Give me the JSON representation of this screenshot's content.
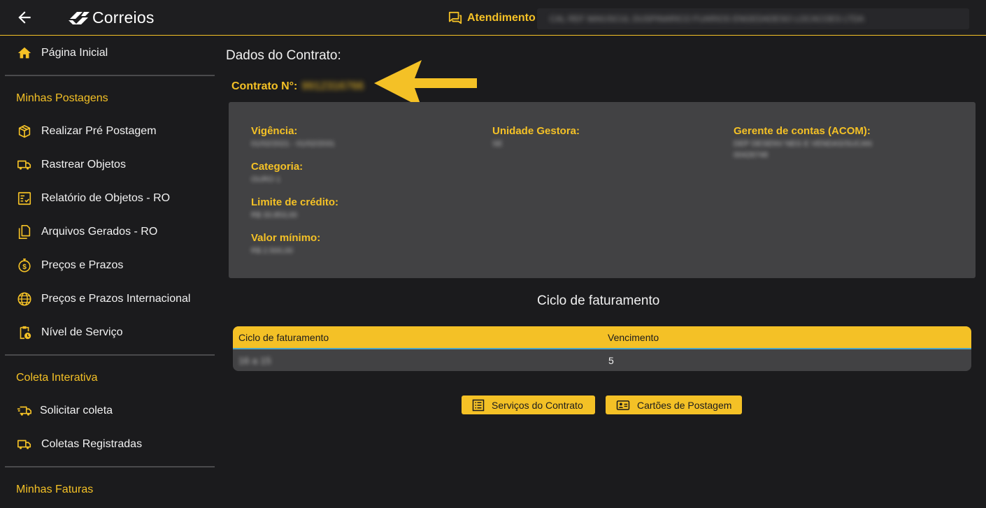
{
  "header": {
    "logo_text": "Correios",
    "atendimento_label": "Atendimento",
    "blurred_info": "CAL REF MAIUSCUL DUSPINARICO FUARIOS ENGEDADESO LOCACOES LTDA"
  },
  "sidebar": {
    "home_label": "Página Inicial",
    "section_postagens": "Minhas Postagens",
    "items_postagens": [
      {
        "label": "Realizar Pré Postagem",
        "icon": "package-icon"
      },
      {
        "label": "Rastrear Objetos",
        "icon": "truck-icon"
      },
      {
        "label": "Relatório de Objetos - RO",
        "icon": "report-icon"
      },
      {
        "label": "Arquivos Gerados - RO",
        "icon": "files-icon"
      },
      {
        "label": "Preços e Prazos",
        "icon": "price-icon"
      },
      {
        "label": "Preços e Prazos Internacional",
        "icon": "globe-icon"
      },
      {
        "label": "Nível de Serviço",
        "icon": "clipboard-clock-icon"
      }
    ],
    "section_coleta": "Coleta Interativa",
    "items_coleta": [
      {
        "label": "Solicitar coleta",
        "icon": "fast-truck-icon"
      },
      {
        "label": "Coletas Registradas",
        "icon": "truck-icon"
      }
    ],
    "section_faturas": "Minhas Faturas"
  },
  "main": {
    "title": "Dados do Contrato:",
    "contract_label": "Contrato N°:",
    "contract_number": "9912316766",
    "fields": {
      "vigencia_label": "Vigência:",
      "vigencia_value": "01/02/2021 - 01/02/2031",
      "categoria_label": "Categoria:",
      "categoria_value": "OURO 1",
      "limite_label": "Limite de crédito:",
      "limite_value": "R$ 33.853,00",
      "valor_label": "Valor mínimo:",
      "valor_value": "R$ 2.500,00",
      "unidade_label": "Unidade Gestora:",
      "unidade_value": "SE",
      "gerente_label": "Gerente de contas (ACOM):",
      "gerente_value_1": "DEP DESENV NEG E VENDAS/SUCAN",
      "gerente_value_2": "00426748"
    },
    "ciclo_title": "Ciclo de faturamento",
    "table": {
      "col_ciclo": "Ciclo de faturamento",
      "col_vencimento": "Vencimento",
      "row_ciclo": "16 a 15",
      "row_vencimento": "5"
    },
    "btn_servicos": "Serviços do Contrato",
    "btn_cartoes": "Cartões de Postagem"
  },
  "colors": {
    "accent": "#f4c126",
    "background": "#1b1b1d",
    "panel": "#424244"
  }
}
